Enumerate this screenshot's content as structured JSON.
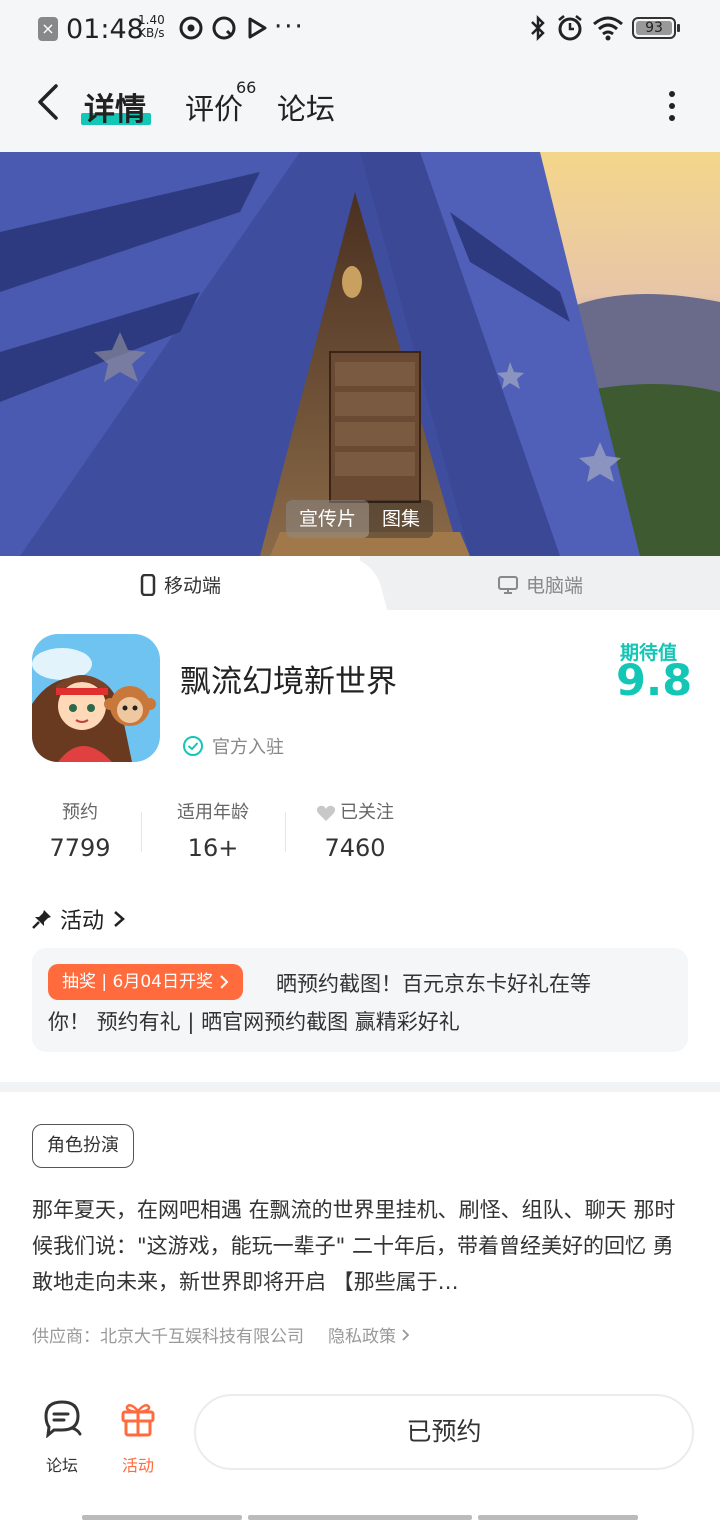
{
  "status_bar": {
    "time": "01:48",
    "speed_value": "1.40",
    "speed_unit": "KB/s",
    "battery": "93",
    "more": "···"
  },
  "nav": {
    "tabs": [
      "详情",
      "评价",
      "论坛"
    ],
    "review_count": "66",
    "active_tab": "详情"
  },
  "media": {
    "tabs": [
      "宣传片",
      "图集"
    ]
  },
  "platforms": {
    "mobile": "移动端",
    "pc": "电脑端"
  },
  "app": {
    "name": "飘流幻境新世界",
    "official": "官方入驻",
    "expect_label": "期待值",
    "expect_value": "9.8"
  },
  "stats": [
    {
      "label": "预约",
      "value": "7799"
    },
    {
      "label": "适用年龄",
      "value": "16+"
    },
    {
      "label": "已关注",
      "value": "7460"
    }
  ],
  "activity": {
    "heading": "活动",
    "tag": "抽奖 | 6月04日开奖",
    "line1": "晒预约截图！百元京东卡好礼在等",
    "line2": "你！ 预约有礼 | 晒官网预约截图 赢精彩好礼"
  },
  "genre": "角色扮演",
  "description": "那年夏天，在网吧相遇 在飘流的世界里挂机、刷怪、组队、聊天 那时候我们说：\"这游戏，能玩一辈子\" 二十年后，带着曾经美好的回忆 勇敢地走向未来，新世界即将开启 【那些属于…",
  "supplier": {
    "text": "供应商：北京大千互娱科技有限公司",
    "privacy": "隐私政策"
  },
  "bottom": {
    "forum": "论坛",
    "activity": "活动",
    "reserved": "已预约"
  },
  "colors": {
    "accent": "#14c6b5",
    "orange": "#ff6b3d"
  }
}
